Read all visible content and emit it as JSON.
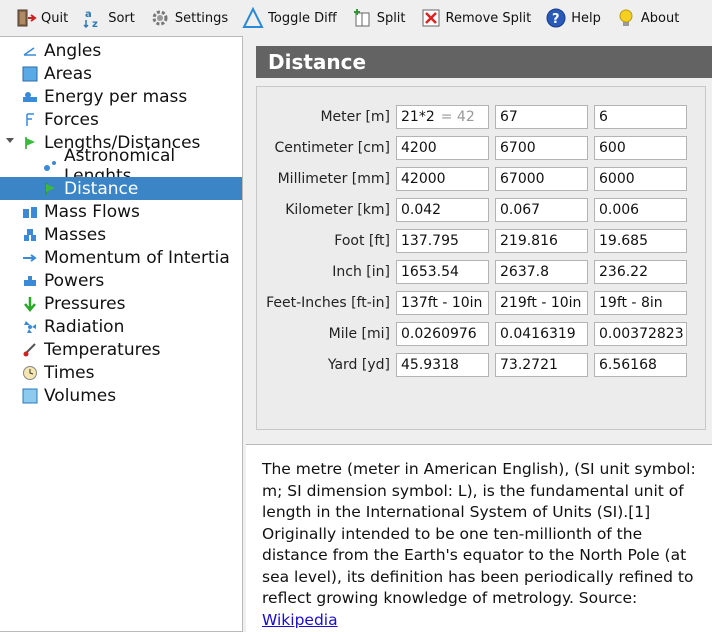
{
  "toolbar": {
    "buttons": [
      {
        "label": "Quit",
        "icon": "door-exit-icon"
      },
      {
        "label": "Sort",
        "icon": "sort-az-icon"
      },
      {
        "label": "Settings",
        "icon": "gear-icon"
      },
      {
        "label": "Toggle Diff",
        "icon": "triangle-delta-icon"
      },
      {
        "label": "Split",
        "icon": "split-plus-icon"
      },
      {
        "label": "Remove Split",
        "icon": "remove-split-icon"
      },
      {
        "label": "Help",
        "icon": "help-question-icon"
      },
      {
        "label": "About",
        "icon": "lightbulb-icon"
      }
    ]
  },
  "sidebar": {
    "items": [
      {
        "label": "Angles",
        "icon": "angle-icon"
      },
      {
        "label": "Areas",
        "icon": "area-square-icon"
      },
      {
        "label": "Energy per mass",
        "icon": "energy-icon"
      },
      {
        "label": "Forces",
        "icon": "force-icon"
      },
      {
        "label": "Lengths/Distances",
        "icon": "length-flag-icon"
      },
      {
        "label": "Astronomical Lenghts",
        "icon": "astronomical-icon"
      },
      {
        "label": "Distance",
        "icon": "distance-flag-icon"
      },
      {
        "label": "Mass Flows",
        "icon": "mass-flow-icon"
      },
      {
        "label": "Masses",
        "icon": "mass-weights-icon"
      },
      {
        "label": "Momentum of Intertia",
        "icon": "momentum-icon"
      },
      {
        "label": "Powers",
        "icon": "power-icon"
      },
      {
        "label": "Pressures",
        "icon": "pressure-arrow-icon"
      },
      {
        "label": "Radiation",
        "icon": "radiation-icon"
      },
      {
        "label": "Temperatures",
        "icon": "thermometer-icon"
      },
      {
        "label": "Times",
        "icon": "clock-icon"
      },
      {
        "label": "Volumes",
        "icon": "volume-cube-icon"
      }
    ],
    "selected": "Distance"
  },
  "main": {
    "title": "Distance",
    "rows": [
      {
        "label": "Meter [m]",
        "values": [
          "21*2",
          "67",
          "6"
        ],
        "hint": "= 42"
      },
      {
        "label": "Centimeter [cm]",
        "values": [
          "4200",
          "6700",
          "600"
        ]
      },
      {
        "label": "Millimeter [mm]",
        "values": [
          "42000",
          "67000",
          "6000"
        ]
      },
      {
        "label": "Kilometer [km]",
        "values": [
          "0.042",
          "0.067",
          "0.006"
        ]
      },
      {
        "label": "Foot [ft]",
        "values": [
          "137.795",
          "219.816",
          "19.685"
        ]
      },
      {
        "label": "Inch [in]",
        "values": [
          "1653.54",
          "2637.8",
          "236.22"
        ]
      },
      {
        "label": "Feet-Inches [ft-in]",
        "values": [
          "137ft - 10in",
          "219ft - 10in",
          "19ft - 8in"
        ]
      },
      {
        "label": "Mile [mi]",
        "values": [
          "0.0260976",
          "0.0416319",
          "0.00372823"
        ]
      },
      {
        "label": "Yard [yd]",
        "values": [
          "45.9318",
          "73.2721",
          "6.56168"
        ]
      }
    ]
  },
  "description": {
    "text": "The metre (meter in American English), (SI unit symbol: m; SI dimension symbol: L), is the fundamental unit of length in the International System of Units (SI).[1] Originally intended to be one ten-millionth of the distance from the Earth's equator to the North Pole (at sea level), its definition has been periodically refined to reflect growing knowledge of metrology. Source: ",
    "link_label": "Wikipedia"
  },
  "colors": {
    "selection": "#3b85c6",
    "header_bar": "#636363",
    "link": "#1a0dcc"
  }
}
